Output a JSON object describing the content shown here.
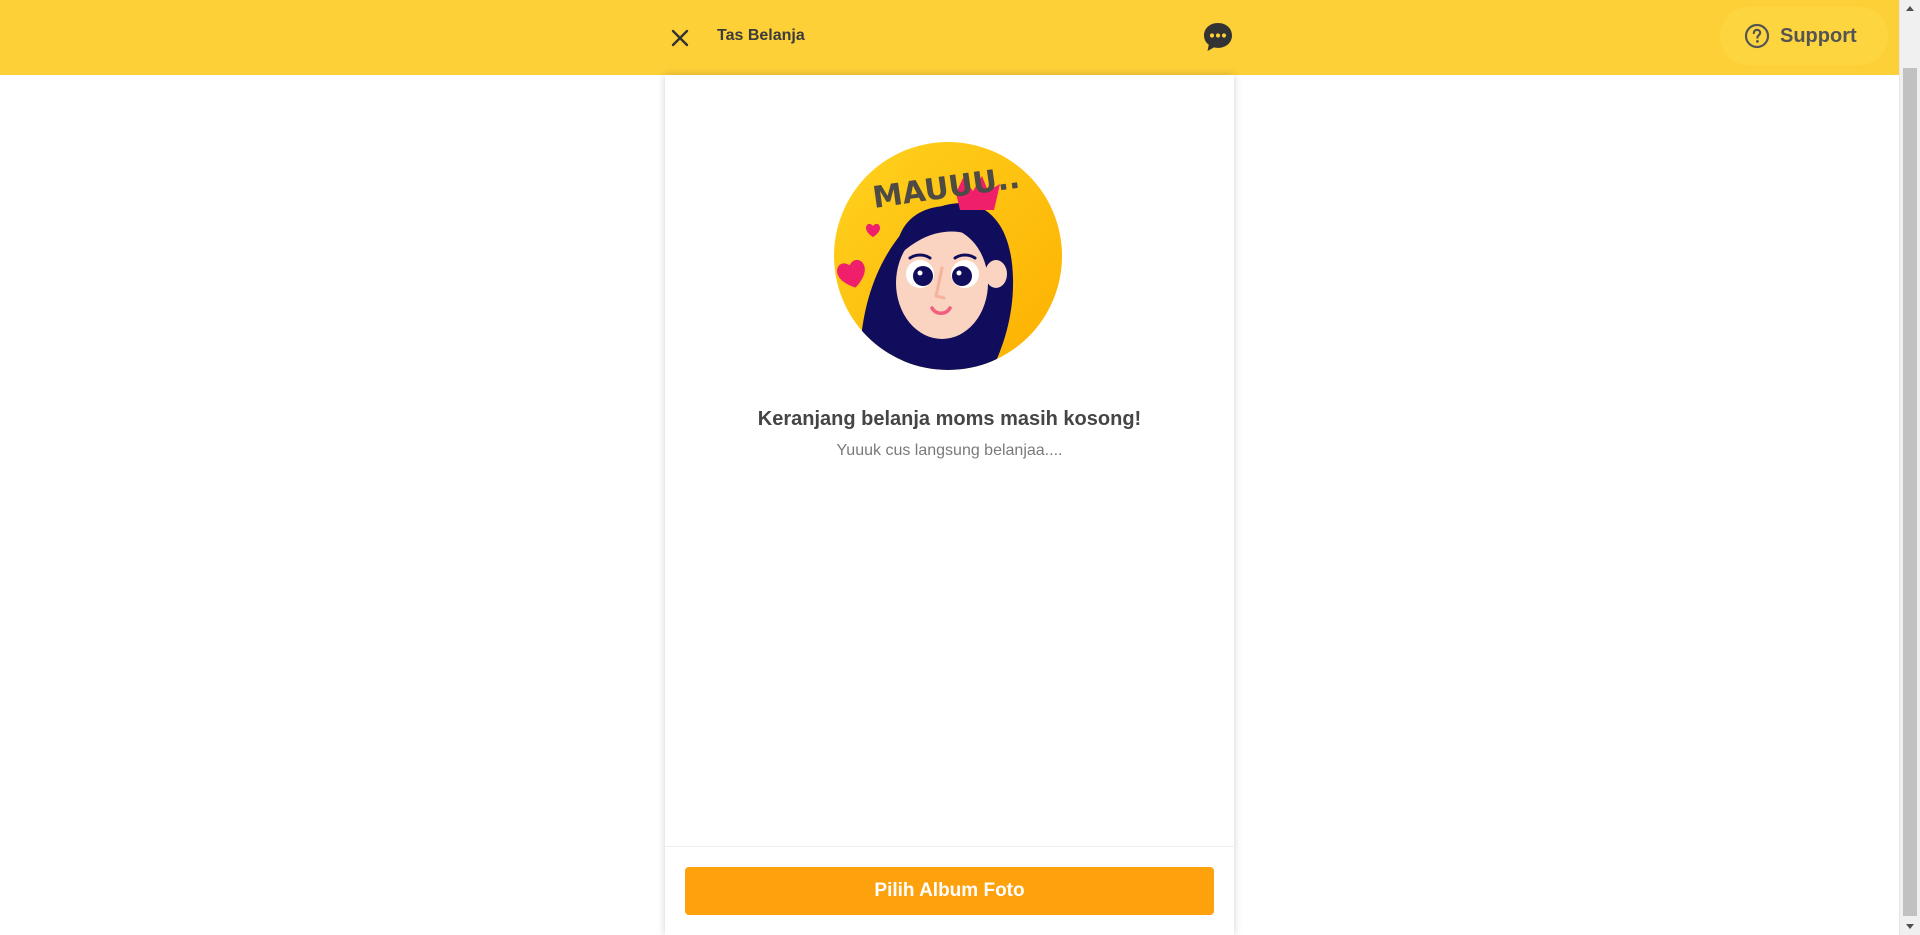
{
  "header": {
    "title": "Tas Belanja",
    "close_icon": "close-icon",
    "chat_icon": "chat-bubble-icon",
    "support_label": "Support",
    "support_icon": "question-circle-icon"
  },
  "empty_state": {
    "illustration_text": "MAUUU..",
    "title": "Keranjang belanja moms masih kosong!",
    "subtitle": "Yuuuk cus langsung belanjaa...."
  },
  "footer": {
    "button_label": "Pilih Album Foto"
  },
  "colors": {
    "header_bg": "#fdd038",
    "support_bg": "#fdd53f",
    "cta_bg": "#fda10c",
    "text_dark": "#3b3b3b",
    "text_muted": "#7a7a7a"
  }
}
